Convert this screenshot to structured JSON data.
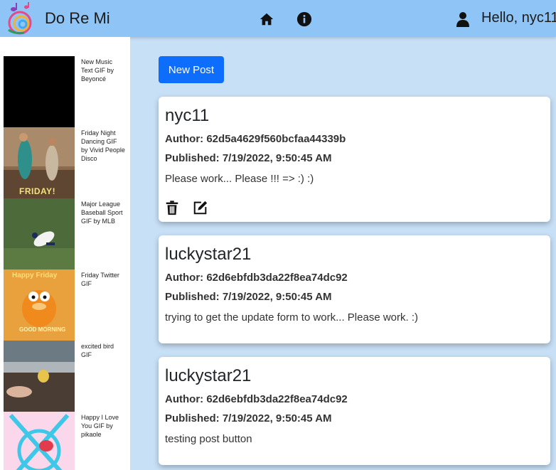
{
  "app": {
    "brand": "Do Re Mi",
    "greeting": "Hello, nyc11"
  },
  "nav": {
    "home_icon": "home-icon",
    "info_icon": "info-icon",
    "user_icon": "user-icon"
  },
  "sidebar": {
    "gifs": [
      {
        "caption": "New Music Text GIF by Beyoncé"
      },
      {
        "caption": "Friday Night Dancing GIF by Vivid People Disco",
        "overlay": "FRIDAY!"
      },
      {
        "caption": "Major League Baseball Sport GIF by MLB"
      },
      {
        "caption": "Friday Twitter GIF",
        "overlay_top": "Happy Friday",
        "overlay_bottom": "GOOD MORNING"
      },
      {
        "caption": "excited bird GIF"
      },
      {
        "caption": "Happy I Love You GIF by pikaole"
      }
    ]
  },
  "main": {
    "new_post_label": "New Post",
    "posts": [
      {
        "title": "nyc11",
        "author": "Author: 62d5a4629f560bcfaa44339b",
        "published": "Published: 7/19/2022, 9:50:45 AM",
        "body": "Please work... Please !!! => :) :)",
        "has_actions": true
      },
      {
        "title": "luckystar21",
        "author": "Author: 62d6ebfdb3da22f8ea74dc92",
        "published": "Published: 7/19/2022, 9:50:45 AM",
        "body": "trying to get the update form to work... Please work. :)"
      },
      {
        "title": "luckystar21",
        "author": "Author: 62d6ebfdb3da22f8ea74dc92",
        "published": "Published: 7/19/2022, 9:50:45 AM",
        "body": "testing post button"
      }
    ]
  },
  "colors": {
    "navbar": "#8ec5f6",
    "background": "#c8e0f6",
    "primary_button": "#0d6efd"
  }
}
